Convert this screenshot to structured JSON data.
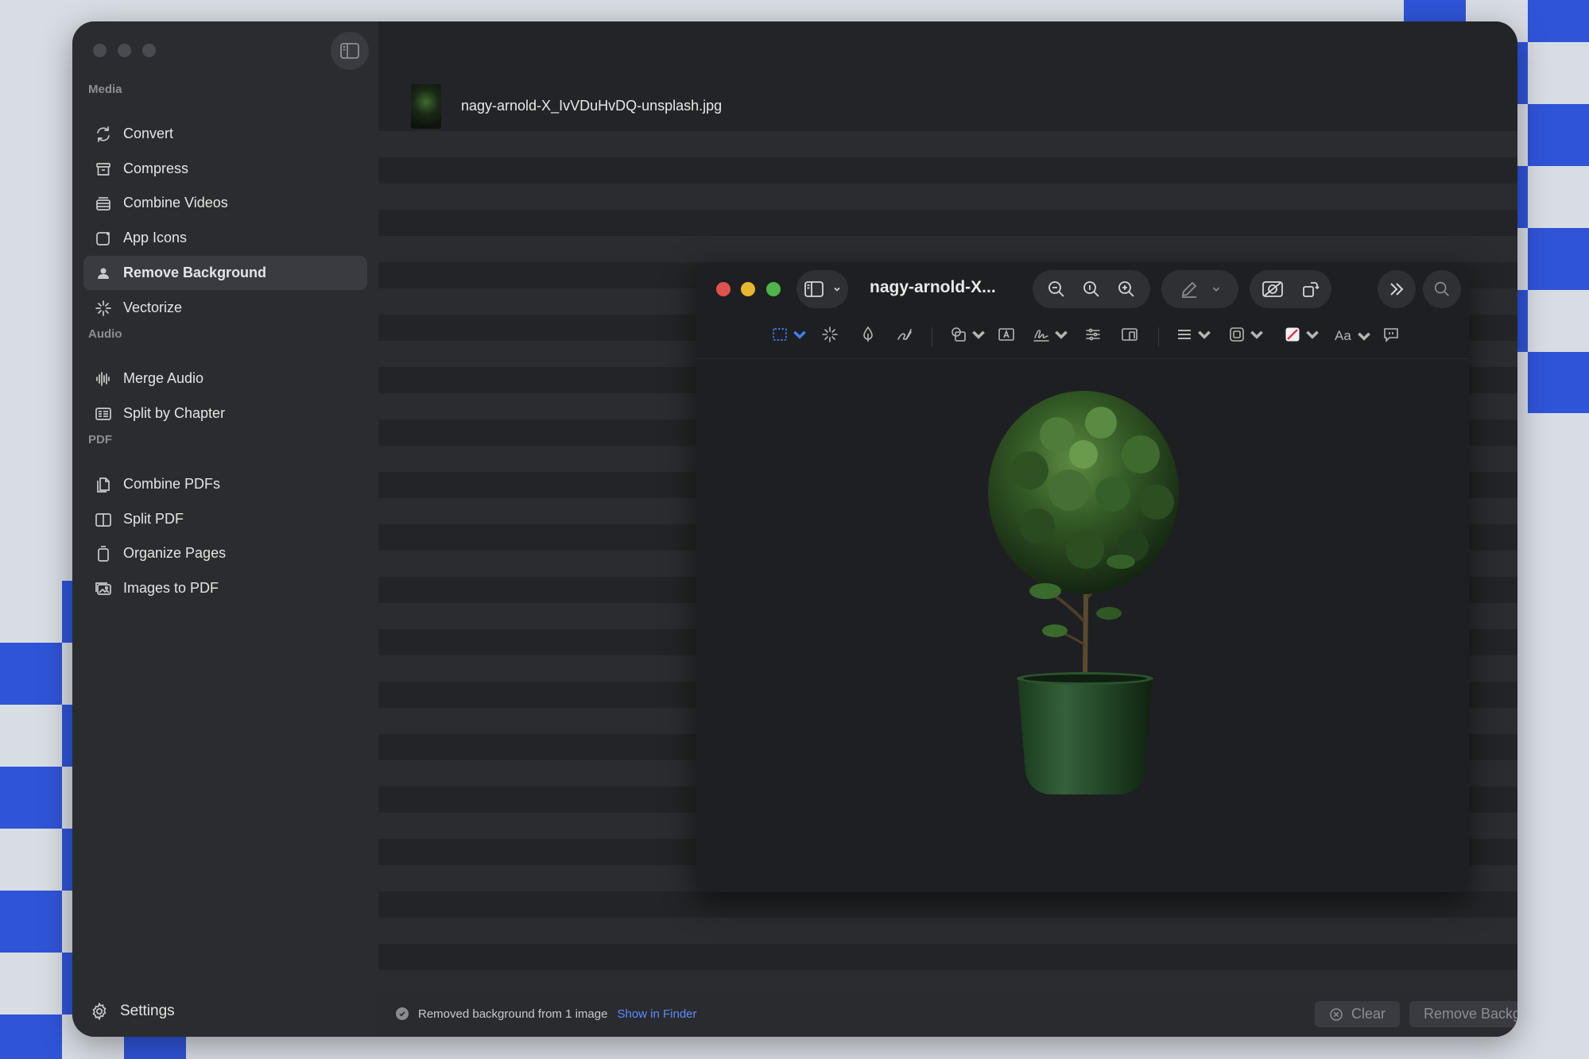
{
  "app": {
    "sidebar": {
      "sections": [
        {
          "label": "Media",
          "items": [
            {
              "label": "Convert",
              "icon": "convert-icon",
              "active": false
            },
            {
              "label": "Compress",
              "icon": "compress-icon",
              "active": false
            },
            {
              "label": "Combine Videos",
              "icon": "combine-videos-icon",
              "active": false
            },
            {
              "label": "App Icons",
              "icon": "app-icons-icon",
              "active": false
            },
            {
              "label": "Remove Background",
              "icon": "person-icon",
              "active": true
            },
            {
              "label": "Vectorize",
              "icon": "sparkle-icon",
              "active": false
            }
          ]
        },
        {
          "label": "Audio",
          "items": [
            {
              "label": "Merge Audio",
              "icon": "waveform-icon",
              "active": false
            },
            {
              "label": "Split by Chapter",
              "icon": "chapter-list-icon",
              "active": false
            }
          ]
        },
        {
          "label": "PDF",
          "items": [
            {
              "label": "Combine PDFs",
              "icon": "combine-pdfs-icon",
              "active": false
            },
            {
              "label": "Split PDF",
              "icon": "split-pdf-icon",
              "active": false
            },
            {
              "label": "Organize Pages",
              "icon": "organize-pages-icon",
              "active": false
            },
            {
              "label": "Images to PDF",
              "icon": "images-icon",
              "active": false
            }
          ]
        }
      ],
      "settings_label": "Settings"
    },
    "file": {
      "name": "nagy-arnold-X_IvVDuHvDQ-unsplash.jpg"
    },
    "status": {
      "message": "Removed background from 1 image",
      "link": "Show in Finder",
      "clear_label": "Clear",
      "action_label": "Remove Background"
    }
  },
  "preview": {
    "title": "nagy-arnold-X...",
    "font_menu_label": "Aa"
  },
  "colors": {
    "accent_link": "#5b8cff",
    "close": "#e0524c",
    "minimize": "#e8b630",
    "zoom": "#4fb54a",
    "checker": "#2f54d8"
  }
}
